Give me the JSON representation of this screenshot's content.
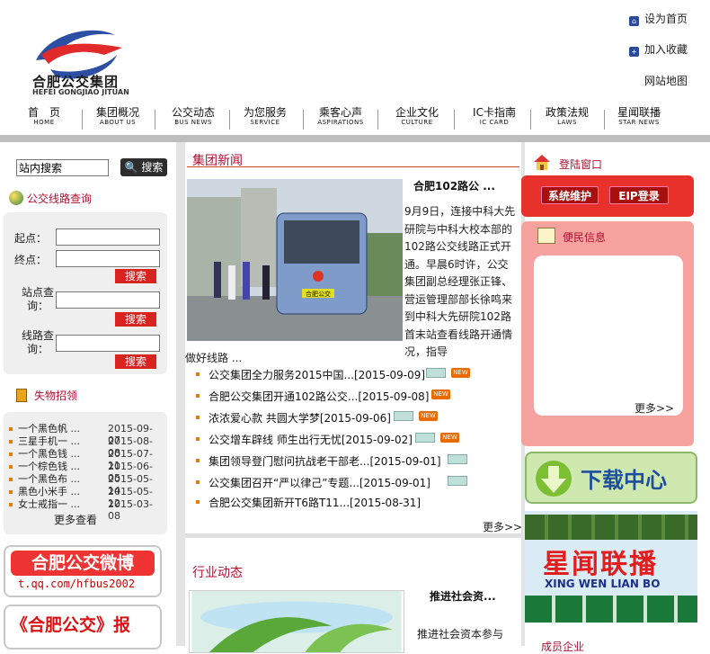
{
  "header": {
    "logo_cn": "合肥公交集团",
    "logo_en": "HEFEI GONGJIAO JITUAN",
    "set_home": "设为首页",
    "add_fav": "加入收藏",
    "sitemap": "网站地图"
  },
  "nav": [
    {
      "cn": "首　页",
      "en": "HOME"
    },
    {
      "cn": "集团概况",
      "en": "ABOUT US"
    },
    {
      "cn": "公交动态",
      "en": "BUS NEWS"
    },
    {
      "cn": "为您服务",
      "en": "SERVICE"
    },
    {
      "cn": "乘客心声",
      "en": "ASPIRATIONS"
    },
    {
      "cn": "企业文化",
      "en": "CULTURE"
    },
    {
      "cn": "IC卡指南",
      "en": "IC CARD"
    },
    {
      "cn": "政策法规",
      "en": "LAWS"
    },
    {
      "cn": "星闻联播",
      "en": "STAR NEWS"
    }
  ],
  "left": {
    "search_value": "站内搜索",
    "search_btn": "搜索",
    "route_title": "公交线路查询",
    "start_label": "起点：",
    "end_label": "终点：",
    "stop_label": "站点查询：",
    "line_label": "线路查询：",
    "btn": "搜索",
    "lost_title": "失物招领",
    "lost_items": [
      {
        "name": "一个黑色帆 ...",
        "date": "2015-09-07"
      },
      {
        "name": "三星手机一 ...",
        "date": "2015-08-08"
      },
      {
        "name": "一个黑色钱 ...",
        "date": "2015-07-11"
      },
      {
        "name": "一个棕色钱 ...",
        "date": "2015-06-05"
      },
      {
        "name": "一个黑色布 ...",
        "date": "2015-05-14"
      },
      {
        "name": "黑色小米手 ...",
        "date": "2015-05-12"
      },
      {
        "name": "女士戒指一 ...",
        "date": "2015-03-08"
      }
    ],
    "lost_more": "更多查看",
    "weibo_title": "合肥公交微博",
    "weibo_url": "t.qq.com/hfbus2002",
    "mag_title": "《合肥公交》报"
  },
  "news": {
    "section_title": "集团新闻",
    "lead_title": "合肥102路公 ...",
    "lead_body": "9月9日，连接中科大先研院与中科大校本部的102路公交线路正式开通。早晨6时许，公交集团副总经理张正锋、营运管理部部长徐鸣来到中科大先研院102路首末站查看线路开通情况，指导",
    "lead_tail": "做好线路 ...",
    "items": [
      {
        "text": "公交集团全力服务2015中国...[2015-09-09]"
      },
      {
        "text": "合肥公交集团开通102路公交...[2015-09-08]"
      },
      {
        "text": "浓浓爱心款 共圆大学梦[2015-09-06]"
      },
      {
        "text": "公交增车辟线 师生出行无忧[2015-09-02]"
      },
      {
        "text": "集团领导登门慰问抗战老干部老...[2015-09-01]"
      },
      {
        "text": "公交集团召开“严以律己”专题...[2015-09-01]"
      },
      {
        "text": "合肥公交集团新开T6路T11...[2015-08-31]"
      }
    ],
    "more": "更多>>",
    "new_tag": "NEW",
    "bus_plate": "合肥公交"
  },
  "industry": {
    "title": "行业动态",
    "lead_title": "推进社会资...",
    "lead_body": "推进社会资本参与"
  },
  "right": {
    "login_title": "登陆窗口",
    "sys_btn": "系统维护",
    "eip_btn": "EIP登录",
    "info_title": "便民信息",
    "info_more": "更多>>",
    "download": "下载中心",
    "star_cn": "星闻联播",
    "star_en": "XING WEN LIAN BO",
    "member_title": "成员企业"
  },
  "colors": {
    "accent_red": "#b01030",
    "button_red": "#d8231f",
    "gray_bar": "#bdbdbd"
  }
}
